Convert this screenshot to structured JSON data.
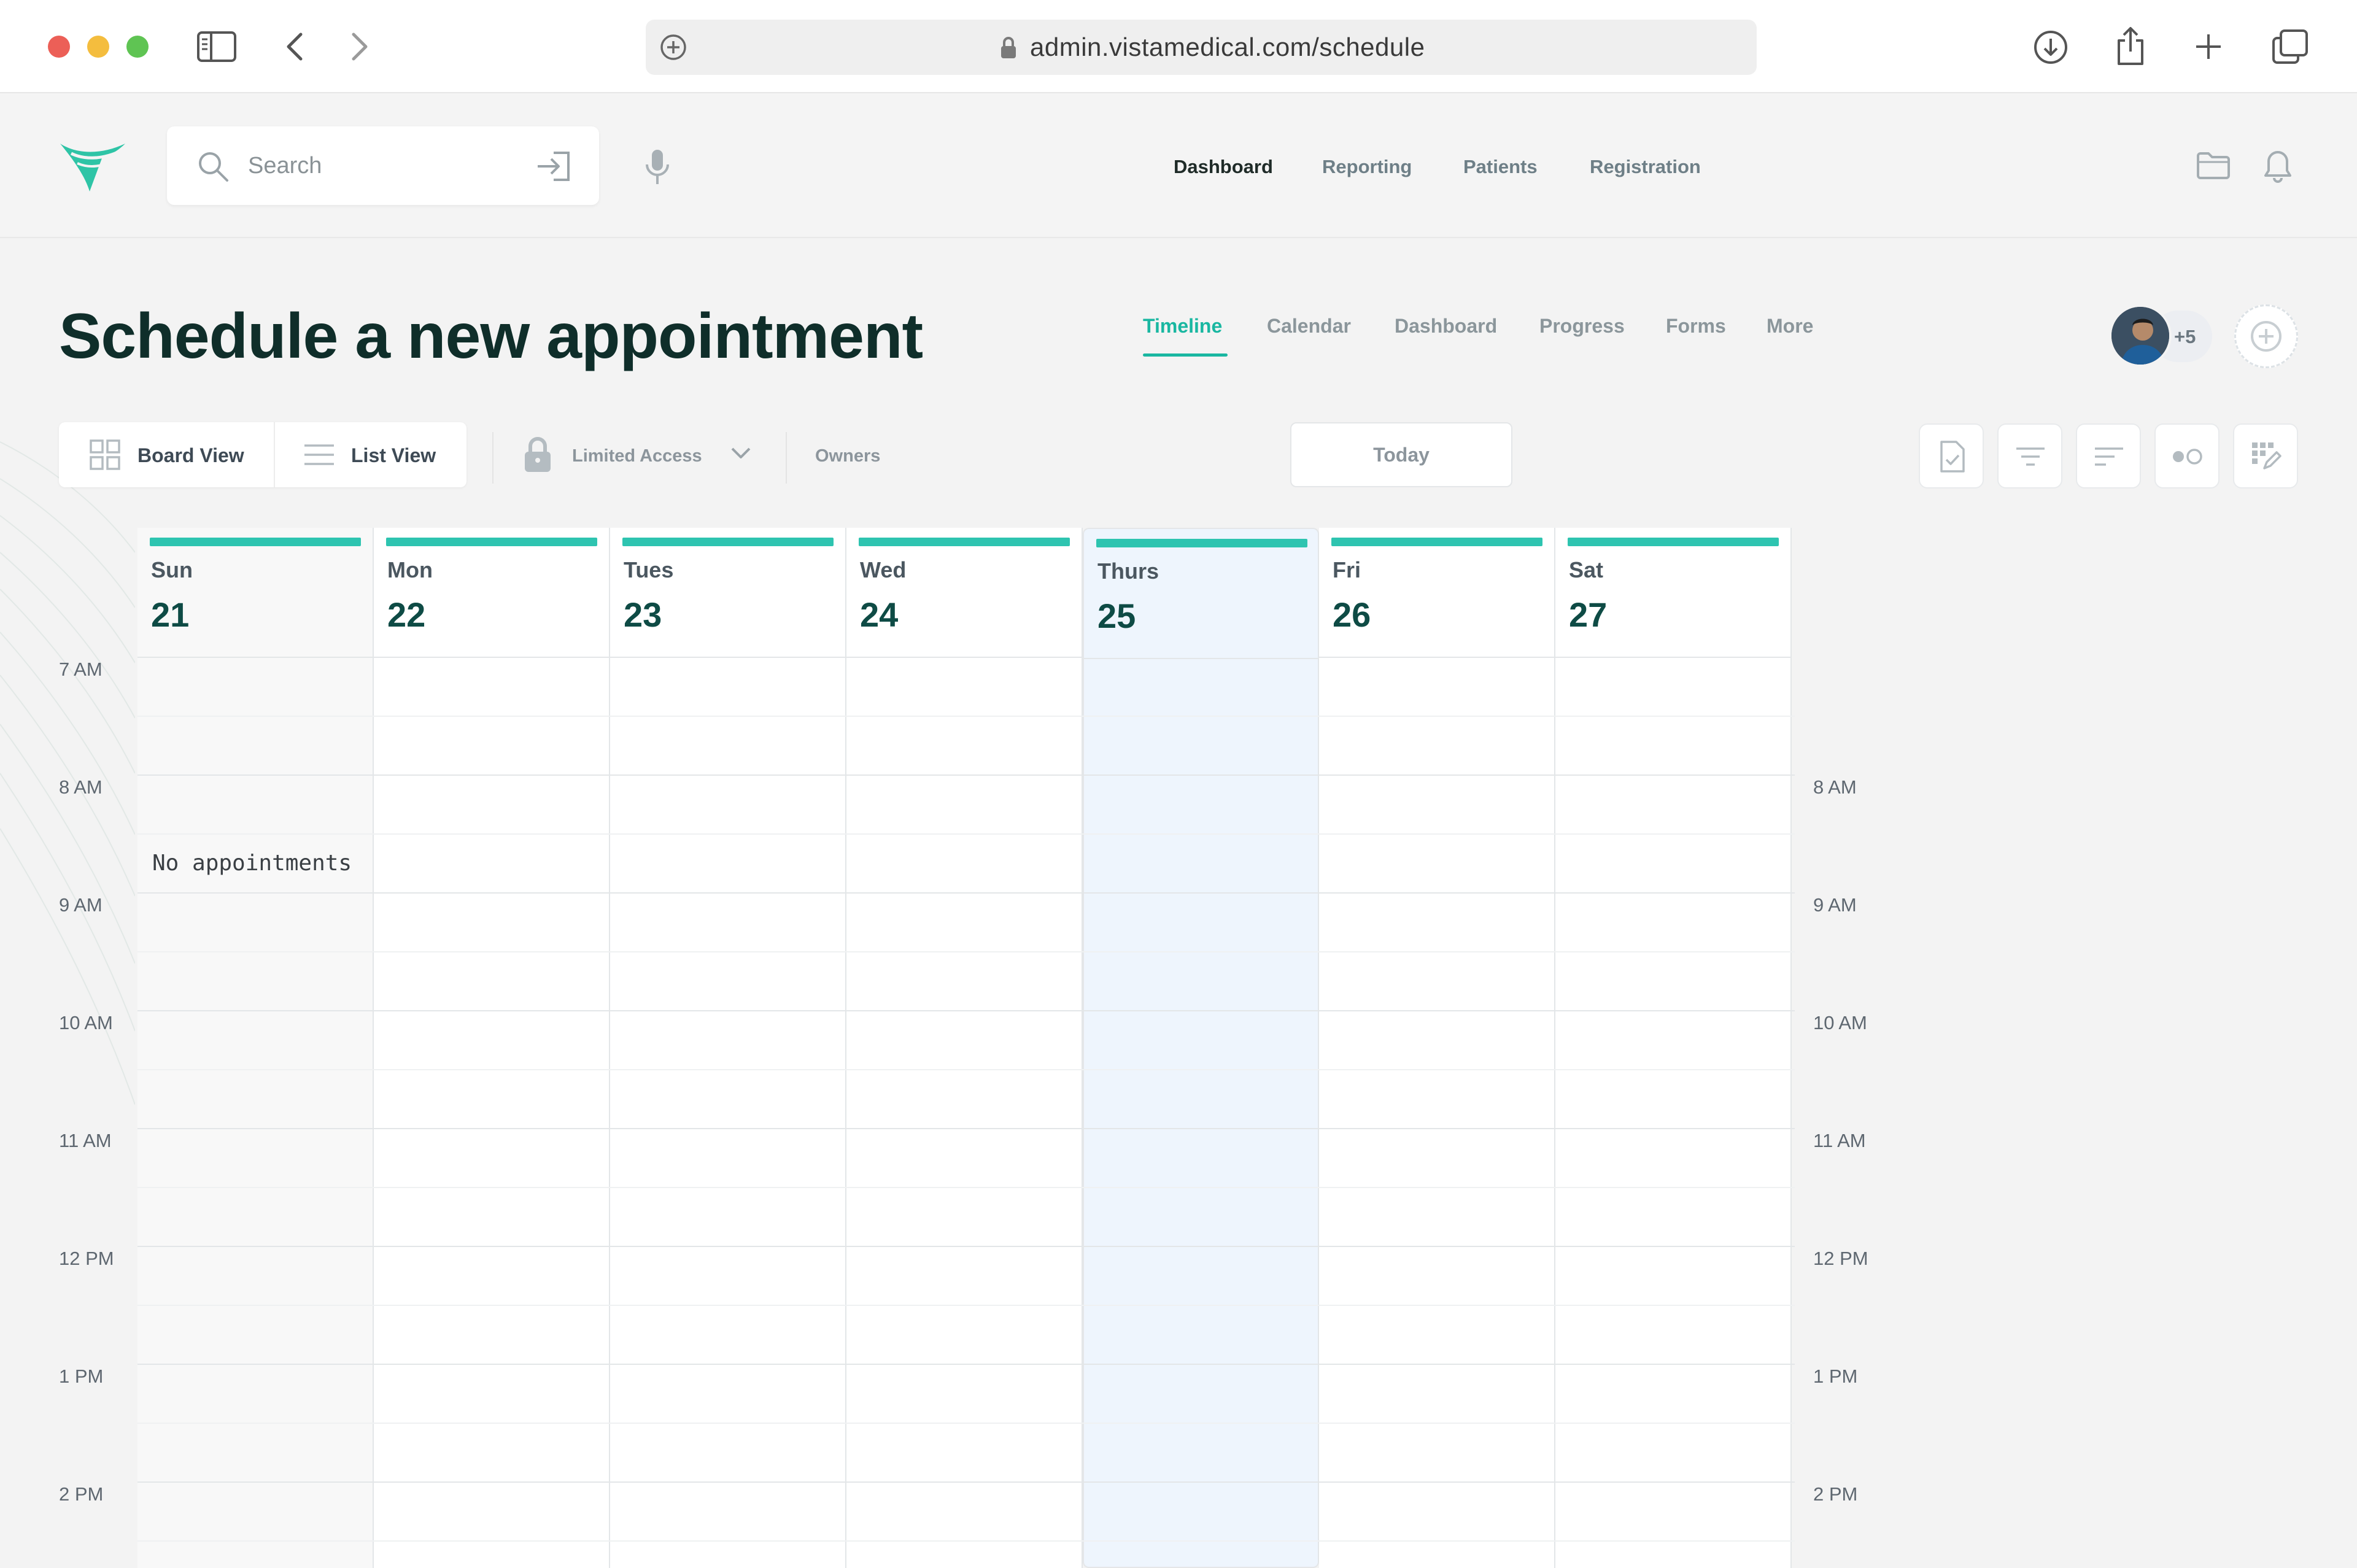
{
  "browser": {
    "url": "admin.vistamedical.com/schedule"
  },
  "header": {
    "search_placeholder": "Search",
    "nav": [
      "Dashboard",
      "Reporting",
      "Patients",
      "Registration"
    ],
    "active_nav": "Dashboard"
  },
  "page": {
    "title": "Schedule a new appointment",
    "tabs": [
      "Timeline",
      "Calendar",
      "Dashboard",
      "Progress",
      "Forms",
      "More"
    ],
    "active_tab": "Timeline",
    "collaborators_more": "+5"
  },
  "toolbar": {
    "board_view": "Board View",
    "list_view": "List View",
    "access": "Limited Access",
    "owners": "Owners",
    "today": "Today"
  },
  "calendar": {
    "days": [
      {
        "name": "Sun",
        "date": "21"
      },
      {
        "name": "Mon",
        "date": "22"
      },
      {
        "name": "Tues",
        "date": "23"
      },
      {
        "name": "Wed",
        "date": "24"
      },
      {
        "name": "Thurs",
        "date": "25"
      },
      {
        "name": "Fri",
        "date": "26"
      },
      {
        "name": "Sat",
        "date": "27"
      }
    ],
    "highlighted_day": "Thurs",
    "times_left": [
      "7 AM",
      "8 AM",
      "9 AM",
      "10 AM",
      "11 AM",
      "12 PM",
      "1 PM",
      "2 PM"
    ],
    "times_right": [
      "8 AM",
      "9 AM",
      "10 AM",
      "11 AM",
      "12 PM",
      "1 PM",
      "2 PM"
    ],
    "empty_message": "No appointments",
    "accent_color": "#2ec4b0"
  }
}
